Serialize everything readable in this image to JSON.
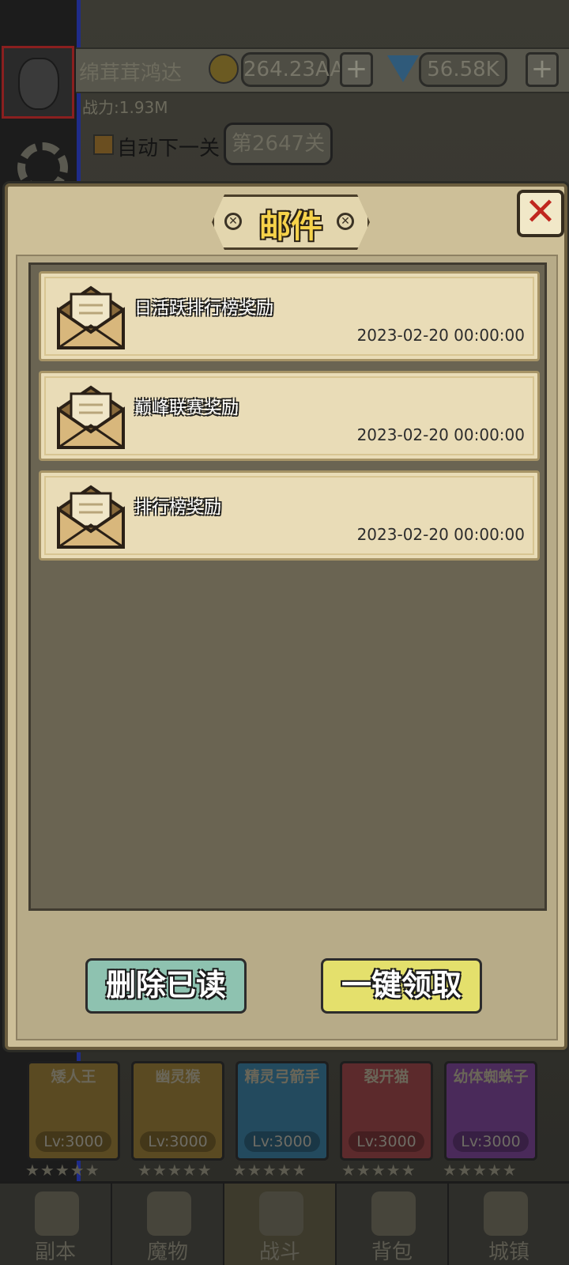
{
  "hud": {
    "player_name": "绵茸茸鸿达",
    "gold": "264.23AA",
    "gems": "56.58K",
    "plus_label": "+",
    "power": "战力:1.93M",
    "auto_next_label": "自动下一关",
    "stage": "第2647关"
  },
  "mail_modal": {
    "title": "邮件",
    "close_label": "✕",
    "items": [
      {
        "subject": "日活跃排行榜奖励",
        "date": "2023-02-20 00:00:00"
      },
      {
        "subject": "巅峰联赛奖励",
        "date": "2023-02-20 00:00:00"
      },
      {
        "subject": "排行榜奖励",
        "date": "2023-02-20 00:00:00"
      }
    ],
    "delete_read_label": "删除已读",
    "claim_all_label": "一键领取"
  },
  "heroes": [
    {
      "name": "矮人王",
      "level": "Lv:3000",
      "stars": 5,
      "color": "#5a4a22"
    },
    {
      "name": "幽灵猴",
      "level": "Lv:3000",
      "stars": 5,
      "color": "#5a4a22"
    },
    {
      "name": "精灵弓箭手",
      "level": "Lv:3000",
      "stars": 5,
      "color": "#234a5e"
    },
    {
      "name": "裂开猫",
      "level": "Lv:3000",
      "stars": 5,
      "color": "#5c2a2c"
    },
    {
      "name": "幼体蜘蛛子",
      "level": "Lv:3000",
      "stars": 5,
      "color": "#4a2a5a"
    }
  ],
  "nav": {
    "tabs": [
      {
        "label": "副本",
        "icon": "map-icon"
      },
      {
        "label": "魔物",
        "icon": "helmet-icon"
      },
      {
        "label": "战斗",
        "icon": "crossed-swords-icon"
      },
      {
        "label": "背包",
        "icon": "backpack-icon"
      },
      {
        "label": "城镇",
        "icon": "shop-icon"
      }
    ],
    "active_index": 2
  }
}
